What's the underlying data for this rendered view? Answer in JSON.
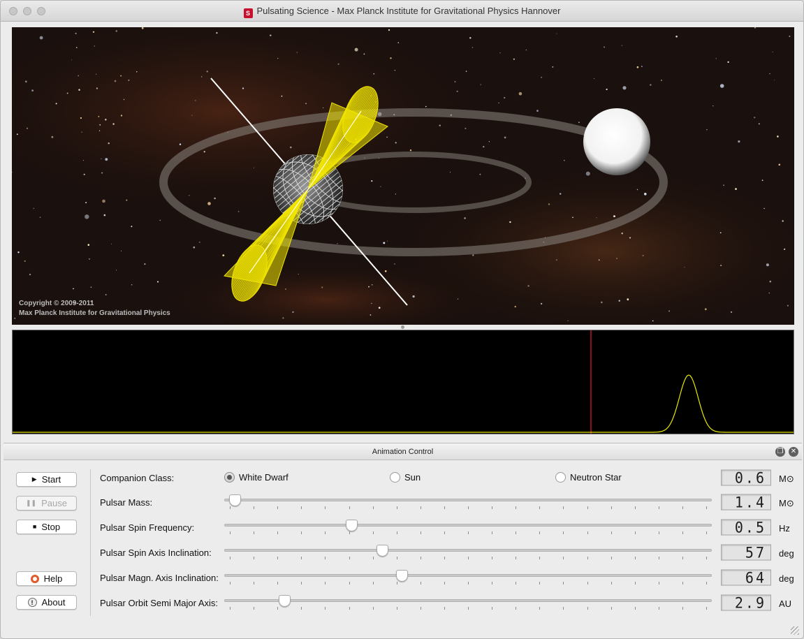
{
  "window": {
    "title": "Pulsating Science - Max Planck Institute for Gravitational Physics Hannover",
    "app_icon": "pulsating-science-logo"
  },
  "scene": {
    "copyright_line1": "Copyright © 2009-2011",
    "copyright_line2": "Max Planck Institute for Gravitational Physics"
  },
  "animation_control": {
    "title": "Animation Control",
    "buttons": {
      "start": "Start",
      "pause": "Pause",
      "stop": "Stop",
      "help": "Help",
      "about": "About"
    },
    "companion": {
      "label": "Companion Class:",
      "options": [
        "White Dwarf",
        "Sun",
        "Neutron Star"
      ],
      "selected": "White Dwarf",
      "value": "0.6",
      "unit": "M⊙"
    },
    "params": [
      {
        "label": "Pulsar Mass:",
        "value": "1.4",
        "unit": "M⊙",
        "level": 0.01
      },
      {
        "label": "Pulsar Spin Frequency:",
        "value": "0.5",
        "unit": "Hz",
        "level": 0.255
      },
      {
        "label": "Pulsar Spin Axis Inclination:",
        "value": "57",
        "unit": "deg",
        "level": 0.32
      },
      {
        "label": "Pulsar Magn. Axis Inclination:",
        "value": "64",
        "unit": "deg",
        "level": 0.36
      },
      {
        "label": "Pulsar Orbit Semi Major Axis:",
        "value": "2.9",
        "unit": "AU",
        "level": 0.115
      }
    ]
  },
  "colors": {
    "beam": "#f2e600",
    "pulse_curve": "#e8e800",
    "marker": "#c0102a"
  }
}
